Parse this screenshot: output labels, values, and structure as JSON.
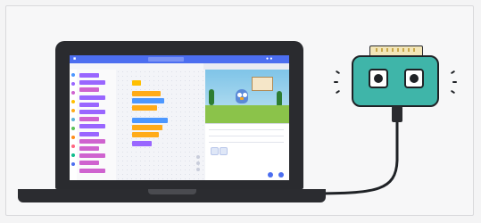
{
  "illustration": {
    "laptop": {
      "screen": {
        "menu_bar": {
          "items": [
            "",
            "",
            ""
          ]
        },
        "tabs": [
          "",
          "",
          ""
        ],
        "category_colors": [
          "#4c97ff",
          "#9966ff",
          "#cf63cf",
          "#ffbf00",
          "#ffab19",
          "#5cb1d6",
          "#59c059",
          "#ff8c1a",
          "#ff6680",
          "#0fbd8c",
          "#4c6ef0"
        ],
        "palette_block_colors": [
          "#9966ff",
          "#9966ff",
          "#cf63cf",
          "#9966ff",
          "#9966ff",
          "#9966ff",
          "#cf63cf",
          "#9966ff",
          "#9966ff",
          "#cf63cf",
          "#cf63cf",
          "#cf63cf",
          "#cf63cf",
          "#cf63cf"
        ],
        "script_block_colors": [
          "#ffbf00",
          "#ffab19",
          "#4c97ff",
          "#ffab19",
          "#4c97ff",
          "#ffab19",
          "#ffab19",
          "#9966ff"
        ],
        "accent": "#4c6ef0"
      }
    },
    "device": {
      "body_color": "#3fb5a9",
      "outline_color": "#1f2226",
      "board_color": "#f3e6b8"
    },
    "cable_color": "#1f2226",
    "background": "#f4f4f5"
  }
}
